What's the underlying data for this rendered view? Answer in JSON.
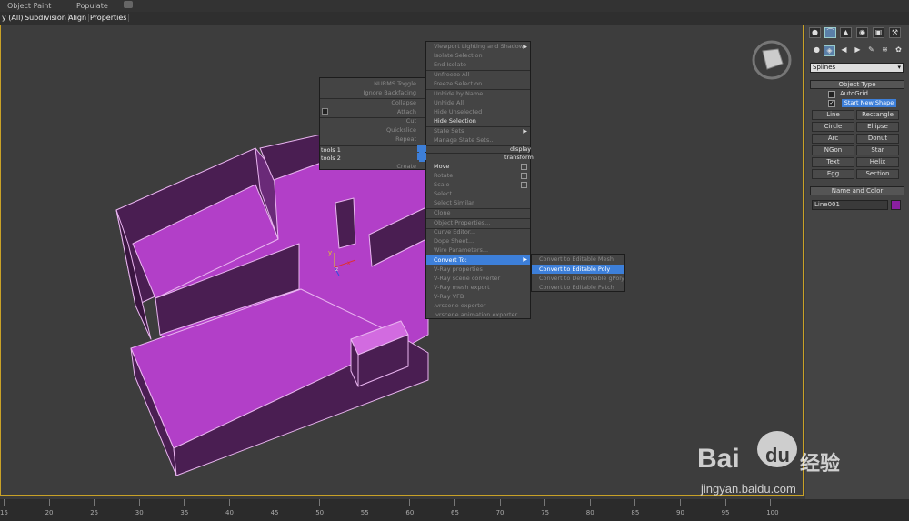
{
  "ribbon": {
    "tab1": "Object Paint",
    "tab2": "Populate"
  },
  "subbar": {
    "i0": "y (All)",
    "i1": "Subdivision",
    "i2": "Align",
    "i3": "Properties"
  },
  "panel": {
    "dropdown": "Splines",
    "object_type_header": "Object Type",
    "autogrid": "AutoGrid",
    "start_new_shape": "Start New Shape",
    "buttons": [
      "Line",
      "Rectangle",
      "Circle",
      "Ellipse",
      "Arc",
      "Donut",
      "NGon",
      "Star",
      "Text",
      "Helix",
      "Egg",
      "Section"
    ],
    "name_color_header": "Name and Color",
    "object_name": "Line001",
    "object_color": "#8a1fa0"
  },
  "left_quad": {
    "items": [
      "NURMS Toggle",
      "Ignore Backfacing",
      "Collapse",
      "Attach",
      "Cut",
      "Quickslice",
      "Repeat"
    ],
    "tools1": "tools 1",
    "tools2": "tools 2",
    "display": "display",
    "transform": "transform",
    "create": "Create"
  },
  "right_quad": {
    "items": [
      "Viewport Lighting and Shadows",
      "Isolate Selection",
      "End Isolate",
      "Unfreeze All",
      "Freeze Selection",
      "Unhide by Name",
      "Unhide All",
      "Hide Unselected",
      "Hide Selection",
      "State Sets",
      "Manage State Sets...",
      "Move",
      "Rotate",
      "Scale",
      "Select",
      "Select Similar",
      "Clone",
      "Object Properties...",
      "Curve Editor...",
      "Dope Sheet...",
      "Wire Parameters...",
      "Convert To:",
      "V-Ray properties",
      "V-Ray scene converter",
      "V-Ray mesh export",
      "V-Ray VFB",
      ".vrscene exporter",
      ".vrscene animation exporter"
    ]
  },
  "submenu": {
    "items": [
      "Convert to Editable Mesh",
      "Convert to Editable Poly",
      "Convert to Deformable gPoly",
      "Convert to Editable Patch"
    ]
  },
  "ruler": {
    "ticks": [
      "15",
      "20",
      "25",
      "30",
      "35",
      "40",
      "45",
      "50",
      "55",
      "60",
      "65",
      "70",
      "75",
      "80",
      "85",
      "90",
      "95",
      "100"
    ]
  },
  "watermark": {
    "brand": "Bai",
    "brand2": "du",
    "cn": "经验",
    "url": "jingyan.baidu.com"
  },
  "colors": {
    "wall": "#9b2fb0",
    "wall_dark": "#4a1e52",
    "floor": "#b23fc8",
    "highlight": "#3d7fd9"
  }
}
